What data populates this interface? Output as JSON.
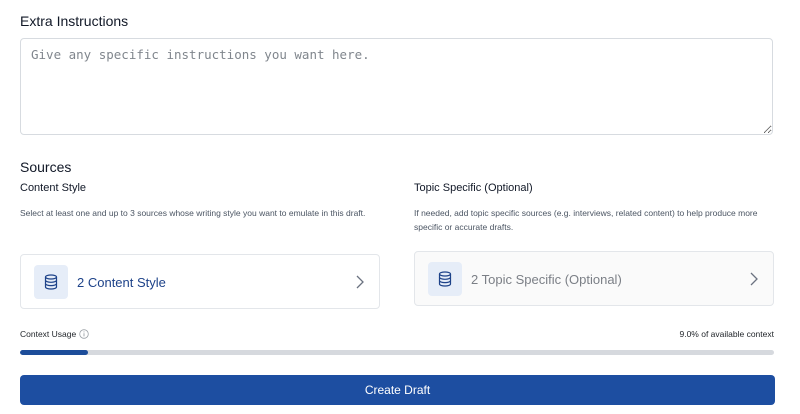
{
  "extra_instructions": {
    "title": "Extra Instructions",
    "placeholder": "Give any specific instructions you want here."
  },
  "sources": {
    "title": "Sources",
    "content_style": {
      "title": "Content Style",
      "description": "Select at least one and up to 3 sources whose writing style you want to emulate in this draft.",
      "card_label": "2 Content Style",
      "icon": "database-icon"
    },
    "topic_specific": {
      "title": "Topic Specific (Optional)",
      "description": "If needed, add topic specific sources (e.g. interviews, related content) to help produce more specific or accurate drafts.",
      "card_label": "2 Topic Specific (Optional)",
      "icon": "database-icon"
    }
  },
  "context_usage": {
    "label": "Context Usage",
    "value_text": "9.0% of available context",
    "percent": 9.0
  },
  "actions": {
    "create_label": "Create Draft"
  },
  "colors": {
    "primary": "#1d4ea1",
    "card_text": "#1d4289",
    "icon_tile": "#e6edf8"
  }
}
